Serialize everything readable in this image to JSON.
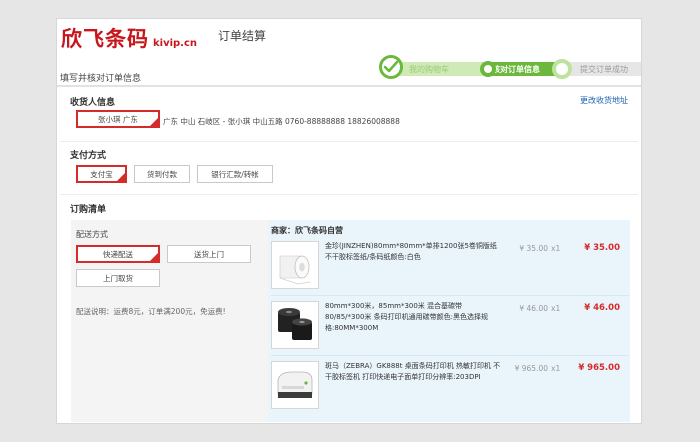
{
  "header": {
    "logo_cn": "欣飞条码",
    "logo_en": "kivip.cn",
    "page_title": "订单结算",
    "sub_title": "填写并核对订单信息"
  },
  "progress": {
    "steps": [
      {
        "label": "我的购物车",
        "state": "done"
      },
      {
        "label": "核对订单信息",
        "state": "current"
      },
      {
        "label": "提交订单成功",
        "state": "todo"
      }
    ],
    "colors": {
      "done": "#cfeab6",
      "current": "#6bb83c",
      "todo": "#e6e6e6"
    }
  },
  "consignee": {
    "title": "收货人信息",
    "selected_label": "张小琪 广东",
    "address": "广东 中山 石岐区 - 张小琪    中山五路    0760-88888888  18826008888",
    "change_link": "更改收货地址"
  },
  "payment": {
    "title": "支付方式",
    "options": [
      "支付宝",
      "货到付款",
      "银行汇款/转帐"
    ],
    "selected_index": 0
  },
  "order": {
    "title": "订购清单",
    "delivery_title": "配送方式",
    "delivery_options": [
      "快递配送",
      "送货上门",
      "上门取货"
    ],
    "delivery_selected_index": 0,
    "delivery_note": "配送说明：运费8元，订单满200元，免运费!",
    "merchant": "商家：欣飞条码自营",
    "items": [
      {
        "name": "金珍(JINZHEN)80mm*80mm*单排1200张5卷铜版纸不干胶标签纸/条码纸颜色:白色",
        "price": "¥ 35.00",
        "qty": "x1",
        "total": "¥ 35.00",
        "image": "label-roll"
      },
      {
        "name": "80mm*300米，85mm*300米 混合基碳带80/85/*300米 条码打印机通用碳带颜色:黑色选择规格:80MM*300M",
        "price": "¥ 46.00",
        "qty": "x1",
        "total": "¥ 46.00",
        "image": "ribbon-rolls"
      },
      {
        "name": "斑马（ZEBRA）GK888t 桌面条码打印机 热敏打印机 不干胶标签机 打印快递电子面单打印分辨率:203DPI",
        "price": "¥ 965.00",
        "qty": "x1",
        "total": "¥ 965.00",
        "image": "label-printer"
      }
    ]
  },
  "colors": {
    "brand_red": "#c8161d",
    "select_red": "#d42b2b",
    "link_blue": "#1e62b2",
    "progress_green": "#6bb83c"
  }
}
